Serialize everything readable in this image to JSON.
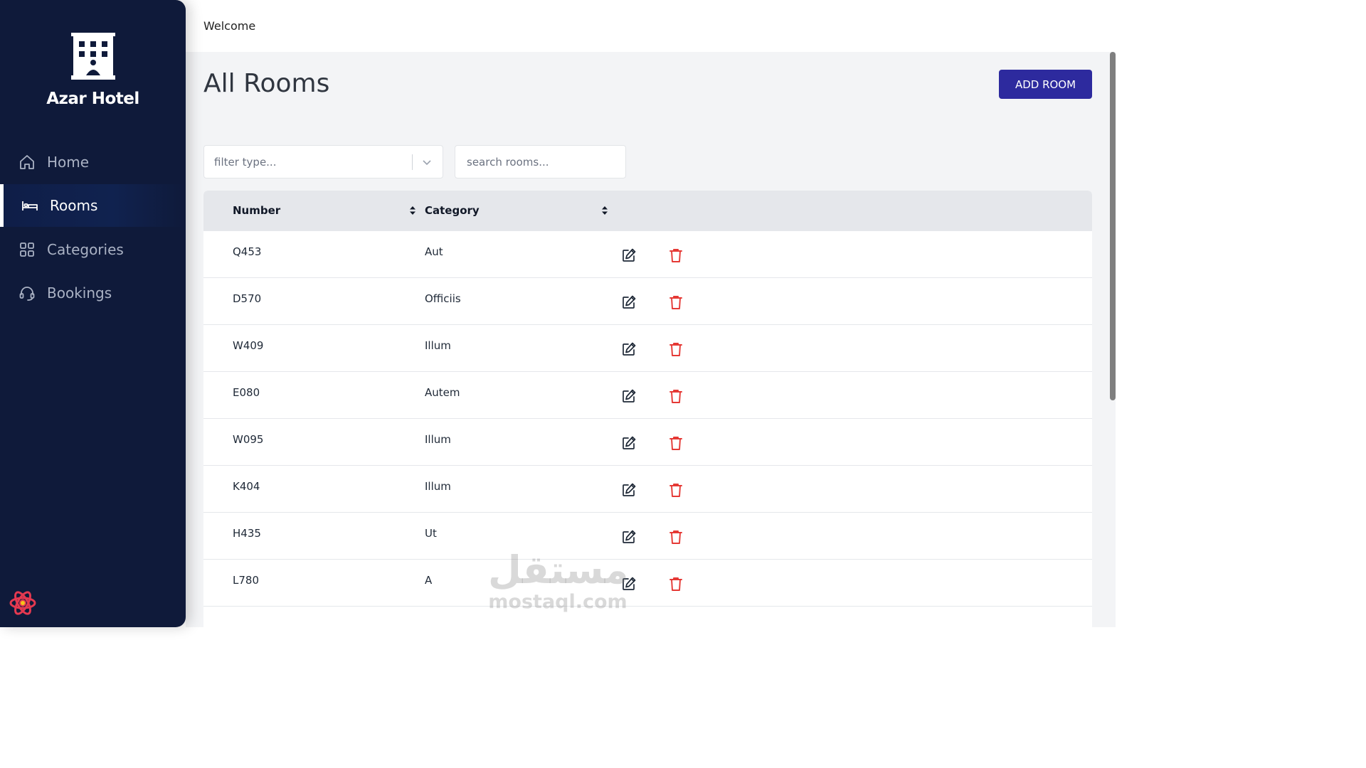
{
  "sidebar": {
    "brand": "Azar Hotel",
    "items": [
      {
        "label": "Home",
        "icon": "home-icon",
        "active": false
      },
      {
        "label": "Rooms",
        "icon": "bed-icon",
        "active": true
      },
      {
        "label": "Categories",
        "icon": "grid-icon",
        "active": false
      },
      {
        "label": "Bookings",
        "icon": "headset-icon",
        "active": false
      }
    ]
  },
  "header": {
    "welcome": "Welcome"
  },
  "main": {
    "title": "All Rooms",
    "add_button": "ADD ROOM",
    "filter_placeholder": "filter type...",
    "search_placeholder": "search rooms..."
  },
  "table": {
    "columns": [
      "Number",
      "Category"
    ],
    "rows": [
      {
        "number": "Q453",
        "category": "Aut"
      },
      {
        "number": "D570",
        "category": "Officiis"
      },
      {
        "number": "W409",
        "category": "Illum"
      },
      {
        "number": "E080",
        "category": "Autem"
      },
      {
        "number": "W095",
        "category": "Illum"
      },
      {
        "number": "K404",
        "category": "Illum"
      },
      {
        "number": "H435",
        "category": "Ut"
      },
      {
        "number": "L780",
        "category": "A"
      }
    ]
  },
  "watermark": {
    "arabic": "مستقل",
    "latin": "mostaql.com"
  },
  "colors": {
    "sidebar": "#0f1a3a",
    "accent_button": "#2d2a9e",
    "delete": "#e53935",
    "main_bg": "#f3f4f6",
    "table_header": "#e5e7eb"
  }
}
